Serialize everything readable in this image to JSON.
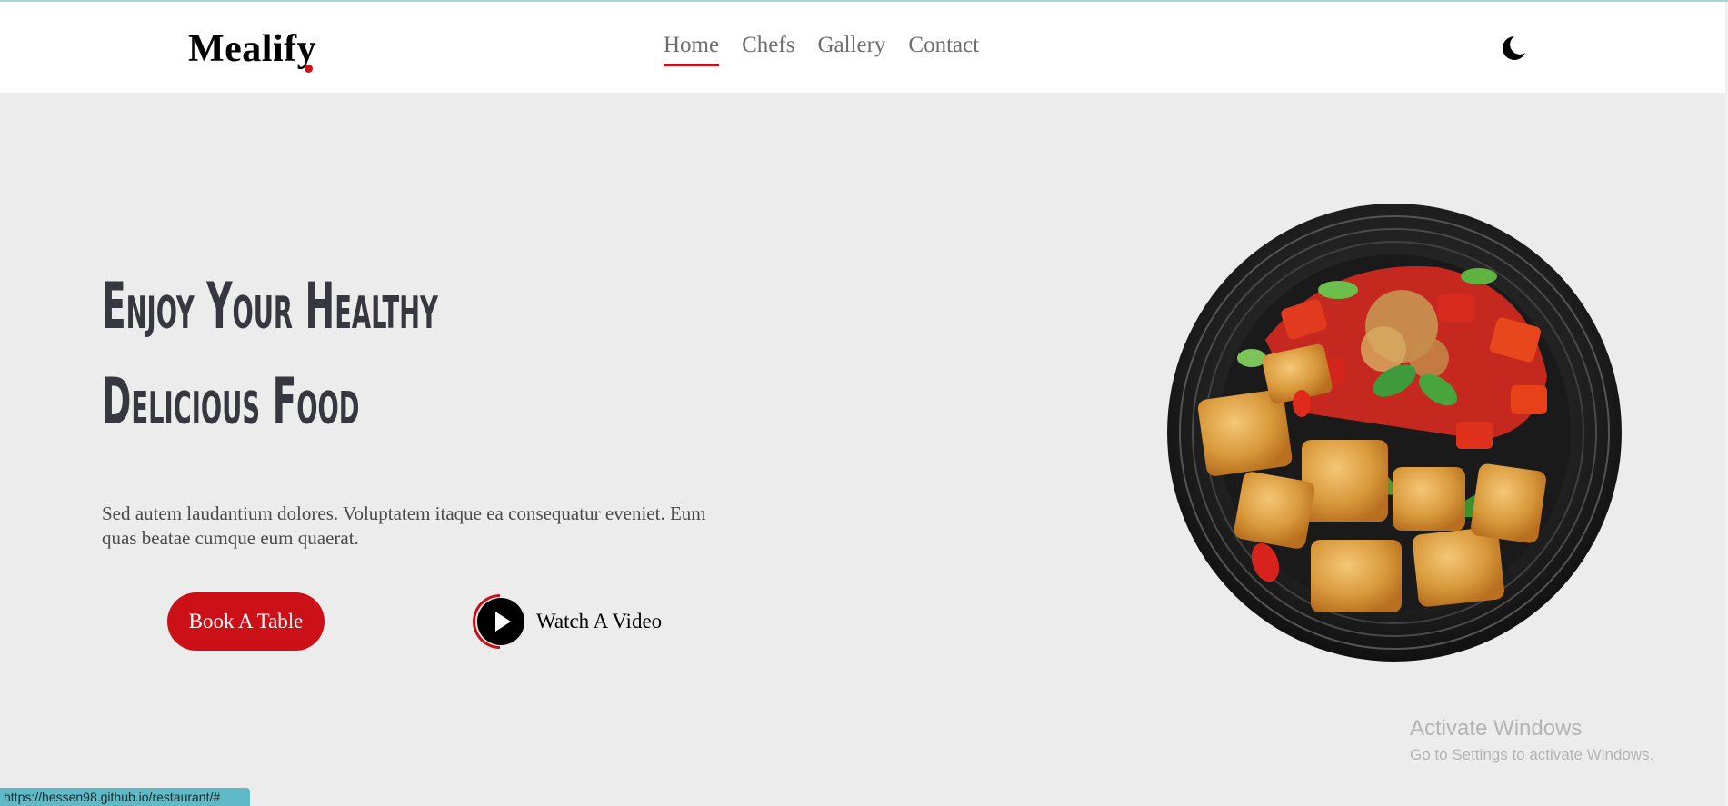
{
  "header": {
    "logo": "Mealify",
    "nav": [
      {
        "label": "Home",
        "active": true
      },
      {
        "label": "Chefs",
        "active": false
      },
      {
        "label": "Gallery",
        "active": false
      },
      {
        "label": "Contact",
        "active": false
      }
    ],
    "theme_icon": "moon-icon"
  },
  "hero": {
    "title_line1": "Enjoy Your Healthy",
    "title_line2": "Delicious Food",
    "description": "Sed autem laudantium dolores. Voluptatem itaque ea consequatur eveniet. Eum quas beatae cumque eum quaerat.",
    "book_button": "Book A Table",
    "video_button": "Watch A Video",
    "video_icon": "play-icon",
    "image": "food-plate-image"
  },
  "overlay": {
    "activate_title": "Activate Windows",
    "activate_subtitle": "Go to Settings to activate Windows."
  },
  "status_bar": {
    "url": "https://hessen98.github.io/restaurant/#"
  },
  "colors": {
    "accent": "#cc1017",
    "background": "#ececec",
    "header": "#ffffff",
    "title": "#37373f"
  }
}
